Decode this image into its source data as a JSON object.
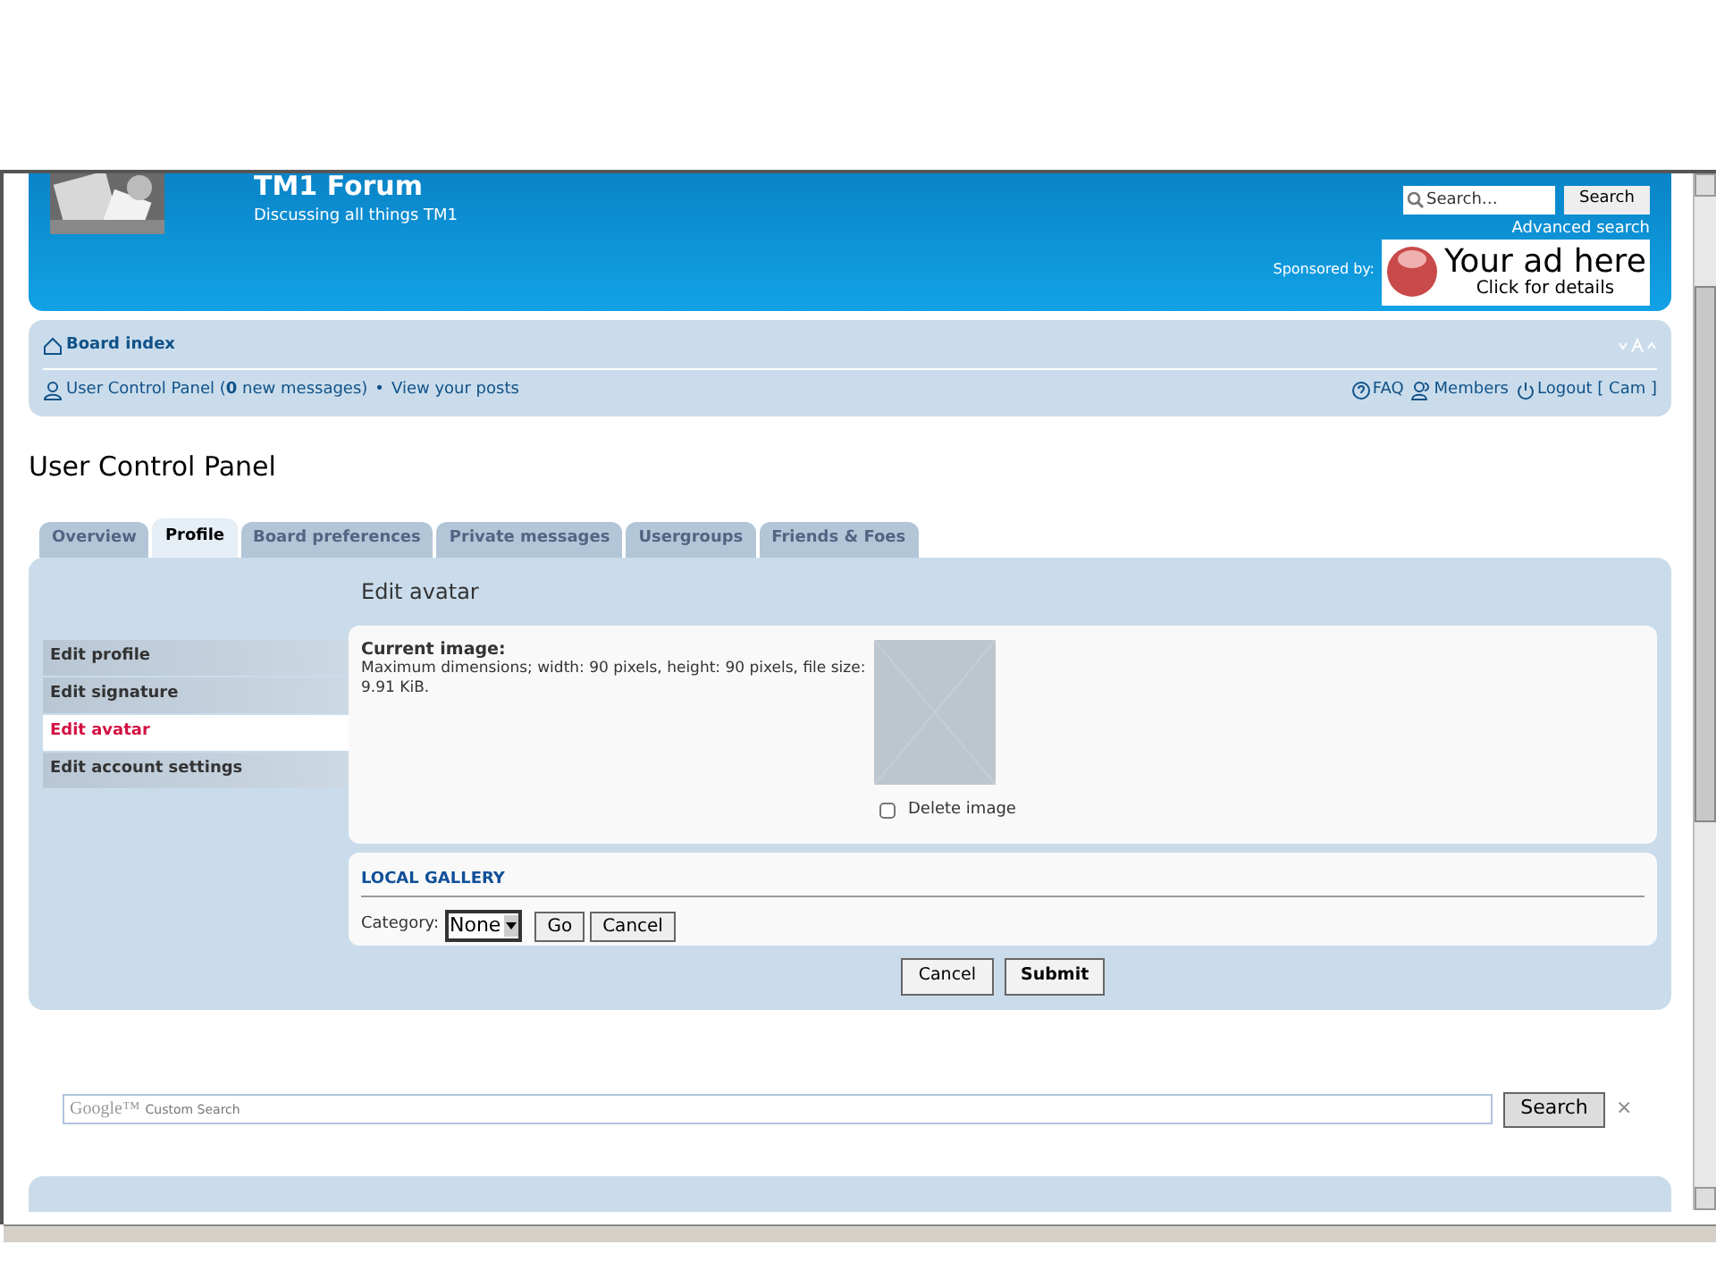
{
  "header": {
    "title": "TM1 Forum",
    "subtitle": "Discussing all things TM1",
    "search": {
      "placeholder": "Search…",
      "button": "Search"
    },
    "advanced_search": "Advanced search",
    "sponsor_label": "Sponsored by:",
    "ad": {
      "headline": "Your ad here",
      "subline": "Click for details"
    }
  },
  "navbar": {
    "breadcrumb": "Board index",
    "user_links": [
      "User Control Panel (**0** new messages)",
      "View your posts"
    ],
    "separator": "•",
    "right_links": [
      {
        "label": "FAQ",
        "kind": "faq"
      },
      {
        "label": "Members",
        "kind": "members"
      },
      {
        "label": "Logout [ Cam ]",
        "kind": "logout"
      }
    ]
  },
  "page_title": "User Control Panel",
  "tabs": [
    {
      "label": "Overview",
      "selected": false
    },
    {
      "label": "Profile",
      "selected": true
    },
    {
      "label": "Board preferences",
      "selected": false
    },
    {
      "label": "Private messages",
      "selected": false
    },
    {
      "label": "Usergroups",
      "selected": false
    },
    {
      "label": "Friends & Foes",
      "selected": false
    }
  ],
  "panel": {
    "heading": "Edit avatar",
    "menu": [
      {
        "label": "Edit profile",
        "selected": false
      },
      {
        "label": "Edit signature",
        "selected": false
      },
      {
        "label": "Edit avatar",
        "selected": true
      },
      {
        "label": "Edit account settings",
        "selected": false
      }
    ],
    "current_image": {
      "label": "Current image:",
      "description": "Maximum dimensions; width: 90 pixels, height: 90 pixels, file size: 9.91 KiB.",
      "delete": {
        "label": "Delete image",
        "checked": false
      }
    },
    "gallery": {
      "title": "LOCAL GALLERY",
      "category_label": "Category:",
      "category_value": "None",
      "buttons": [
        "Go",
        "Cancel"
      ]
    },
    "buttons": [
      {
        "label": "Cancel",
        "kind": "secondary"
      },
      {
        "label": "Submit",
        "kind": "primary"
      }
    ]
  },
  "custom_search": {
    "brand": "Google™",
    "placeholder": "Custom Search",
    "button": "Search",
    "close": "×"
  }
}
